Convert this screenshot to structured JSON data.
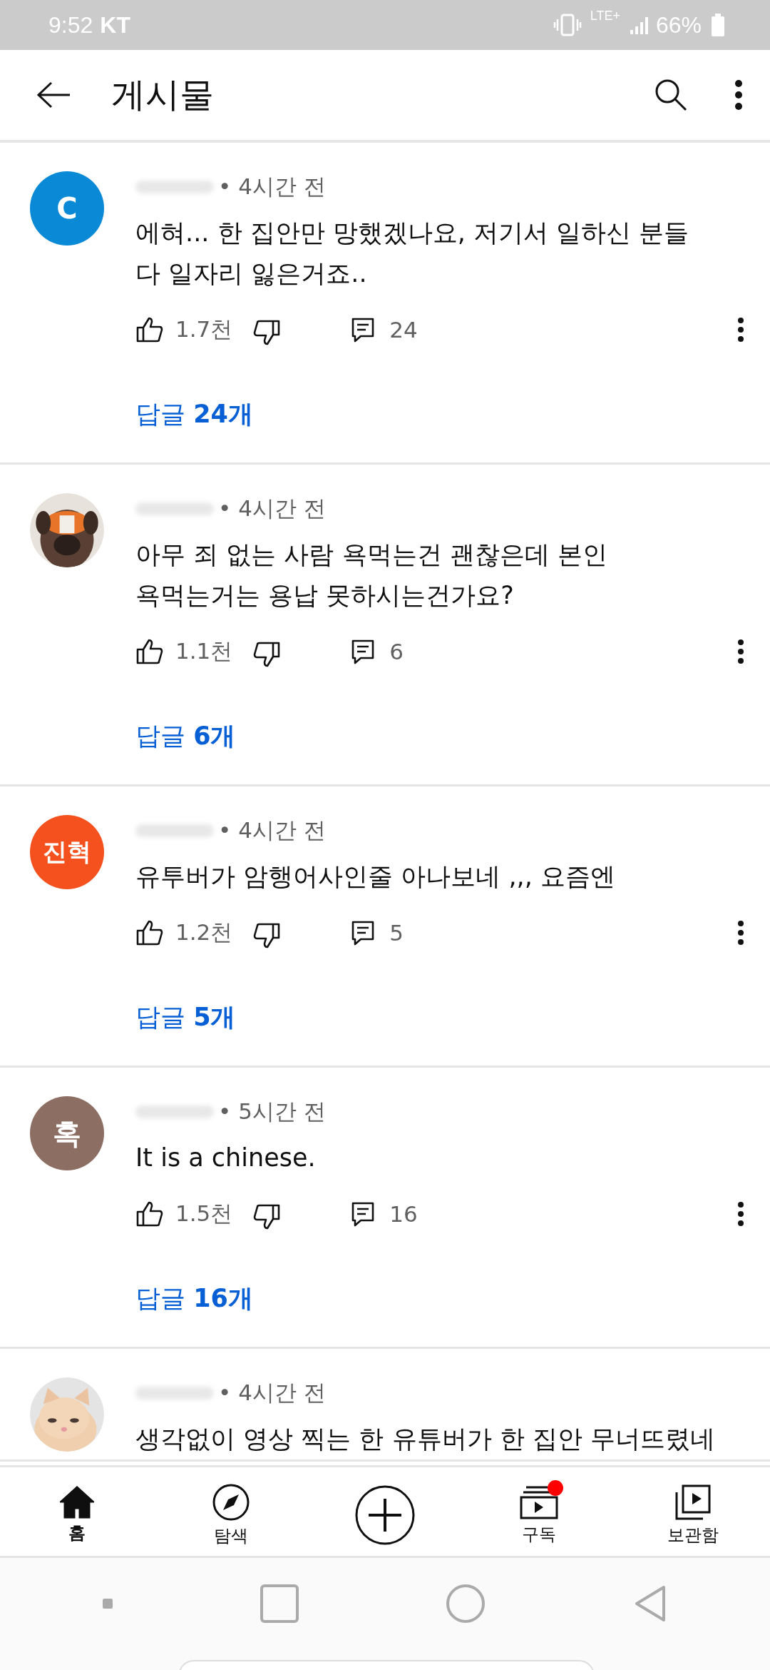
{
  "status_bar": {
    "time": "9:52",
    "carrier": "KT",
    "network": "LTE+",
    "battery": "66%"
  },
  "app_bar": {
    "title": "게시물"
  },
  "comments": [
    {
      "avatar": {
        "kind": "letter",
        "text": "C",
        "color": "#0a8ad6"
      },
      "time": "• 4시간 전",
      "lines": [
        "에혀... 한 집안만 망했겠나요, 저기서 일하신 분들",
        "다 일자리 잃은거죠.."
      ],
      "likes": "1.7천",
      "reply_count": "24",
      "replies": "답글 **24개**"
    },
    {
      "avatar": {
        "kind": "picture"
      },
      "time": "• 4시간 전",
      "lines": [
        "아무 죄 없는 사람 욕먹는건 괜찮은데 본인",
        "욕먹는거는 용납 못하시는건가요?"
      ],
      "likes": "1.1천",
      "reply_count": "6",
      "replies": "답글 **6개**"
    },
    {
      "avatar": {
        "kind": "letter",
        "text": "진혁",
        "color": "#f4511e"
      },
      "time": "• 4시간 전",
      "lines": [
        "유투버가 암행어사인줄 아나보네 ,,, 요즘엔"
      ],
      "likes": "1.2천",
      "reply_count": "5",
      "replies": "답글 **5개**"
    },
    {
      "avatar": {
        "kind": "letter",
        "text": "혹",
        "color": "#8d6e63"
      },
      "time": "• 5시간 전",
      "lines": [
        "It is a chinese."
      ],
      "likes": "1.5천",
      "reply_count": "16",
      "replies": "답글 **16개**"
    },
    {
      "avatar": {
        "kind": "picture"
      },
      "time": "• 4시간 전",
      "lines": [
        "생각없이 영상 찍는 한 유튜버가 한 집안 무너뜨렸네"
      ]
    }
  ],
  "bottom_nav": [
    {
      "kind": "home",
      "label": "홈",
      "selected": true
    },
    {
      "kind": "explore",
      "label": "탐색",
      "selected": false
    },
    {
      "kind": "create",
      "selected": false
    },
    {
      "kind": "subscriptions",
      "label": "구독",
      "selected": false,
      "badge": true
    },
    {
      "kind": "library",
      "label": "보관함",
      "selected": false
    }
  ]
}
